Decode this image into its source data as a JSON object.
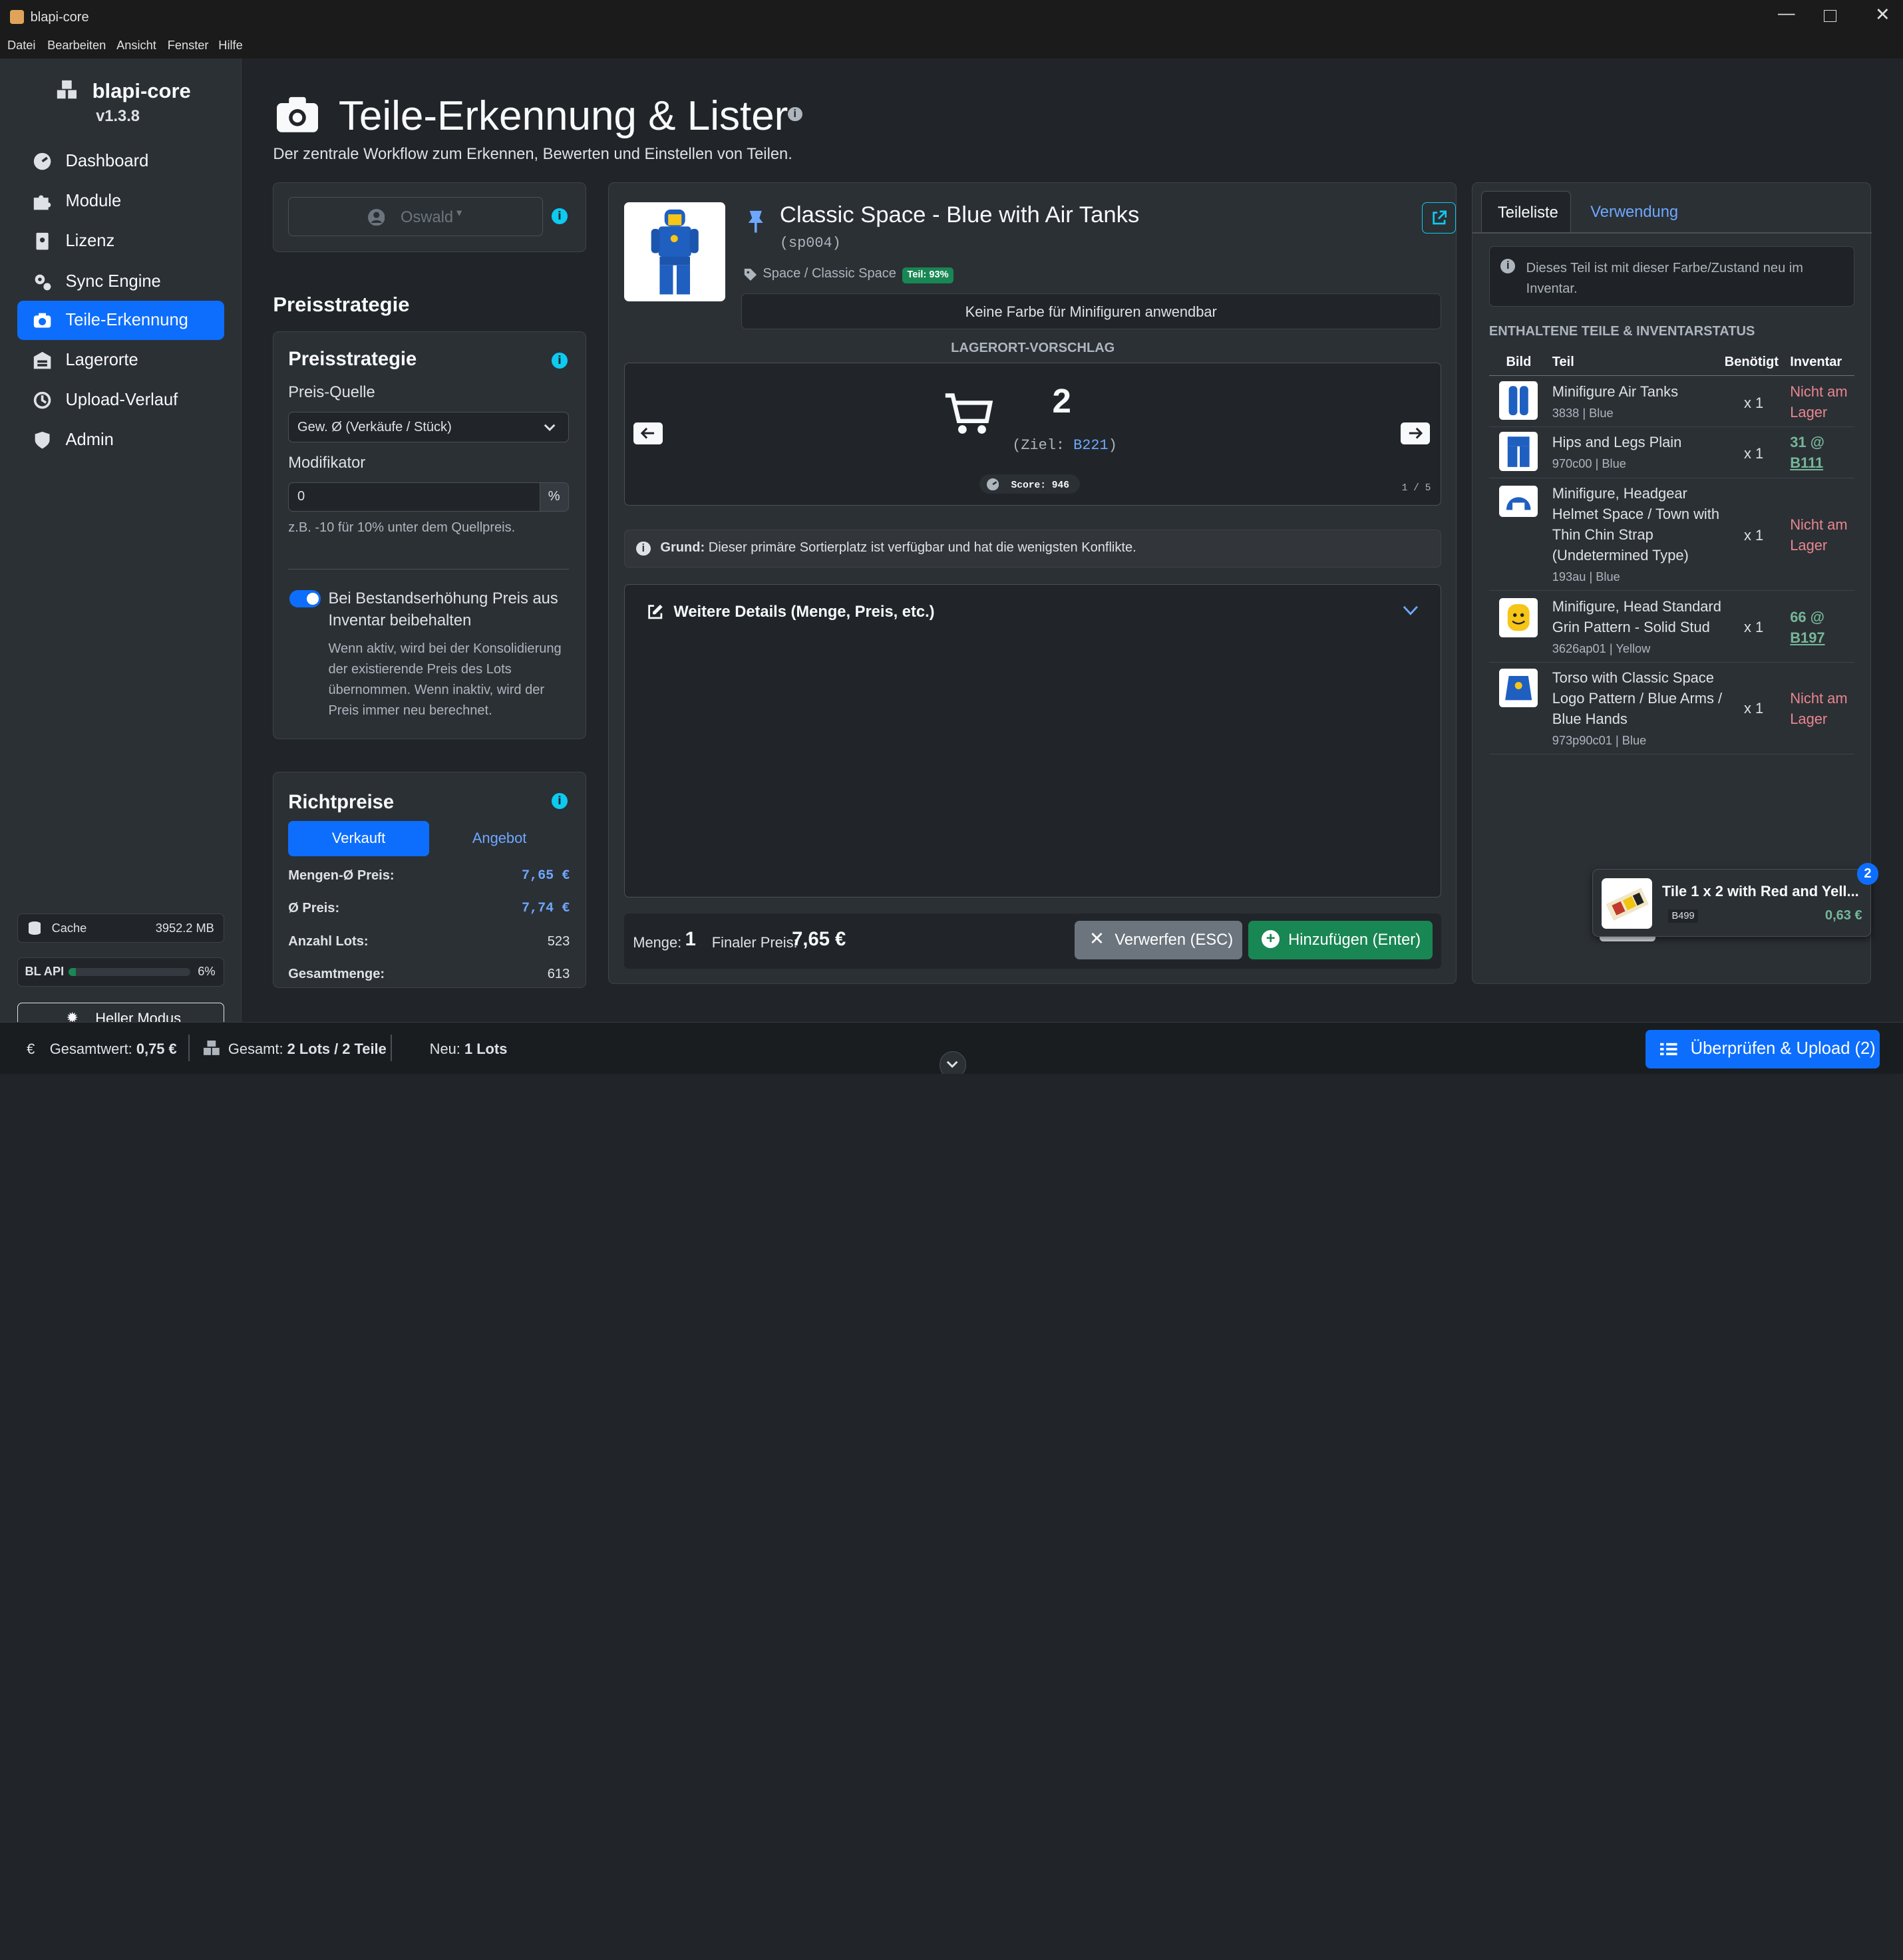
{
  "window": {
    "title": "blapi-core"
  },
  "menu": [
    "Datei",
    "Bearbeiten",
    "Ansicht",
    "Fenster",
    "Hilfe"
  ],
  "sidebar": {
    "app_name": "blapi-core",
    "version": "v1.3.8",
    "items": [
      {
        "label": "Dashboard"
      },
      {
        "label": "Module"
      },
      {
        "label": "Lizenz"
      },
      {
        "label": "Sync Engine"
      },
      {
        "label": "Teile-Erkennung"
      },
      {
        "label": "Lagerorte"
      },
      {
        "label": "Upload-Verlauf"
      },
      {
        "label": "Admin"
      }
    ],
    "cache_label": "Cache",
    "cache_value": "3952.2 MB",
    "blapi_label": "BL API",
    "blapi_value": "6%",
    "blapi_fill": 0.06,
    "theme_button": "Heller Modus"
  },
  "page": {
    "title": "Teile-Erkennung & Lister",
    "subtitle": "Der zentrale Workflow zum Erkennen, Bewerten und Einstellen von Teilen."
  },
  "left": {
    "user": "Oswald",
    "section_title": "Preisstrategie",
    "strategy_card_title": "Preisstrategie",
    "price_source_label": "Preis-Quelle",
    "price_source_value": "Gew. Ø (Verkäufe / Stück)",
    "modifier_label": "Modifikator",
    "modifier_value": "0",
    "modifier_unit": "%",
    "modifier_help": "z.B. -10 für 10% unter dem Quellpreis.",
    "toggle_label": "Bei Bestandserhöhung Preis aus Inventar beibehalten",
    "toggle_help": "Wenn aktiv, wird bei der Konsolidierung der existierende Preis des Lots übernommen. Wenn inaktiv, wird der Preis immer neu berechnet.",
    "richtpreise_title": "Richtpreise",
    "tab_sold": "Verkauft",
    "tab_offer": "Angebot",
    "stats": [
      {
        "label": "Mengen-Ø Preis:",
        "value": "7,65 €"
      },
      {
        "label": "Ø Preis:",
        "value": "7,74 €"
      },
      {
        "label": "Anzahl Lots:",
        "value": "523"
      },
      {
        "label": "Gesamtmenge:",
        "value": "613"
      }
    ]
  },
  "center": {
    "item_name": "Classic Space - Blue with Air Tanks",
    "item_id": "(sp004)",
    "category": "Space / Classic Space",
    "badge": "Teil: 93%",
    "color_note": "Keine Farbe für Minifiguren anwendbar",
    "location_header": "LAGERORT-VORSCHLAG",
    "location_count": "2",
    "target_prefix": "(Ziel: ",
    "target_value": "B221",
    "target_suffix": ")",
    "score": "Score: 946",
    "pager": "1 / 5",
    "reason_label": "Grund:",
    "reason_text": "Dieser primäre Sortierplatz ist verfügbar und hat die wenigsten Konflikte.",
    "details_label": "Weitere Details (Menge, Preis, etc.)",
    "qty_label": "Menge:",
    "qty_value": "1",
    "final_label": "Finaler Preis:",
    "final_value": "7,65 €",
    "discard_button": "Verwerfen (ESC)",
    "add_button": "Hinzufügen (Enter)"
  },
  "right": {
    "tab_parts": "Teileliste",
    "tab_usage": "Verwendung",
    "alert": "Dieses Teil ist mit dieser Farbe/Zustand neu im Inventar.",
    "section_title": "ENTHALTENE TEILE & INVENTARSTATUS",
    "columns": [
      "Bild",
      "Teil",
      "Benötigt",
      "Inventar"
    ],
    "rows": [
      {
        "name": "Minifigure Air Tanks",
        "sub": "3838 | Blue",
        "qty": "x 1",
        "inv": "Nicht am Lager",
        "inv2": ""
      },
      {
        "name": "Hips and Legs Plain",
        "sub": "970c00 | Blue",
        "qty": "x 1",
        "inv": "31 @",
        "inv2": "B111"
      },
      {
        "name": "Minifigure, Headgear Helmet Space / Town with Thin Chin Strap (Undetermined Type)",
        "sub": "193au | Blue",
        "qty": "x 1",
        "inv": "Nicht am Lager",
        "inv2": ""
      },
      {
        "name": "Minifigure, Head Standard Grin Pattern - Solid Stud",
        "sub": "3626ap01 | Yellow",
        "qty": "x 1",
        "inv": "66 @",
        "inv2": "B197"
      },
      {
        "name": "Torso with Classic Space Logo Pattern / Blue Arms / Blue Hands",
        "sub": "973p90c01 | Blue",
        "qty": "x 1",
        "inv": "Nicht am Lager",
        "inv2": ""
      }
    ]
  },
  "toast": {
    "title": "Tile 1 x 2 with Red and Yell...",
    "code": "B499",
    "price": "0,63 €",
    "count": "2"
  },
  "footer": {
    "total_label": "Gesamtwert:",
    "total_value": "0,75 €",
    "sum_label": "Gesamt:",
    "sum_value": "2 Lots / 2 Teile",
    "new_label": "Neu:",
    "new_value": "1 Lots",
    "upload_button": "Überprüfen & Upload (2)"
  },
  "colors": {
    "accent": "#0d6efd",
    "success": "#198754",
    "info": "#0dcaf0",
    "danger": "#ea868f"
  }
}
